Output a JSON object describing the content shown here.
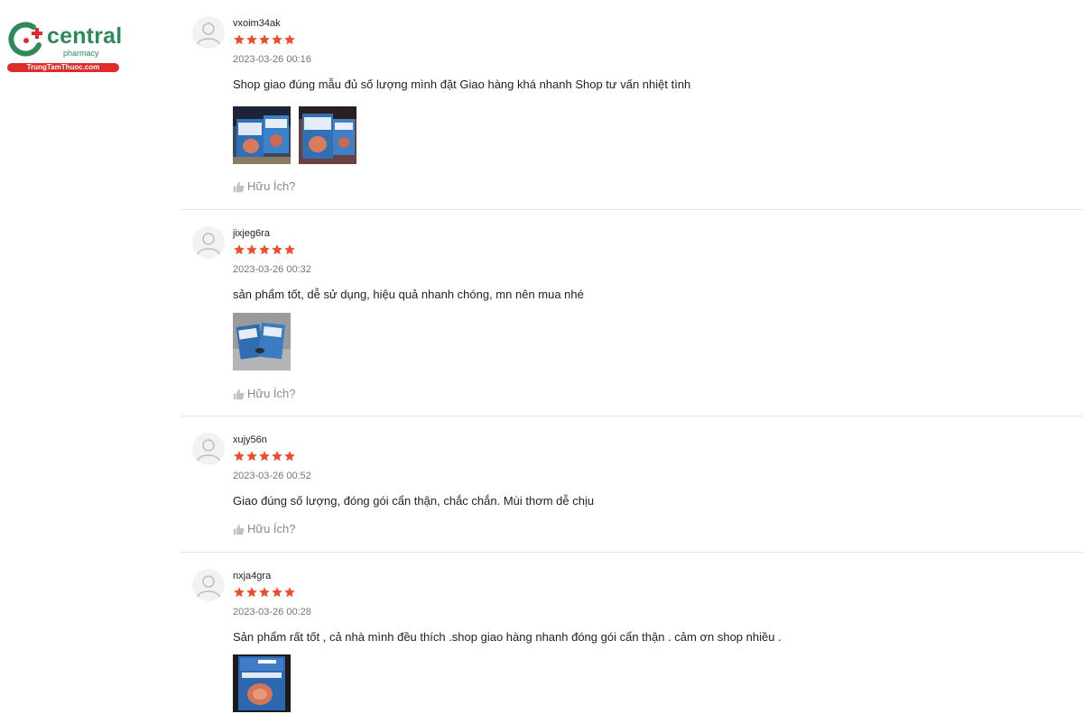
{
  "brand": {
    "name": "central",
    "sub": "pharmacy",
    "url": "TrungTamThuoc.com",
    "colors": {
      "green": "#2e8b57",
      "red": "#e02b2b"
    }
  },
  "star_color": "#ee4d2d",
  "helpful_label": "Hữu Ích?",
  "reviews": [
    {
      "username": "vxoim34ak",
      "rating": 5,
      "date": "2023-03-26 00:16",
      "text": "Shop giao đúng mẫu đủ số lượng mình đặt Giao hàng khá nhanh Shop tư vấn nhiệt tình",
      "photo_count": 2
    },
    {
      "username": "jixjeg6ra",
      "rating": 5,
      "date": "2023-03-26 00:32",
      "text": "sản phẩm tốt, dễ sử dụng, hiệu quả nhanh chóng, mn nên mua nhé",
      "photo_count": 1
    },
    {
      "username": "xujy56n",
      "rating": 5,
      "date": "2023-03-26 00:52",
      "text": "Giao đúng số lượng, đóng gói cẩn thận, chắc chắn. Mùi thơm dễ chịu",
      "photo_count": 0
    },
    {
      "username": "nxja4gra",
      "rating": 5,
      "date": "2023-03-26 00:28",
      "text": "Sản phẩm rất tốt , cả nhà mình đều thích .shop giao hàng nhanh đóng gói cẩn thận . cảm ơn shop nhiều .",
      "photo_count": 1
    }
  ]
}
